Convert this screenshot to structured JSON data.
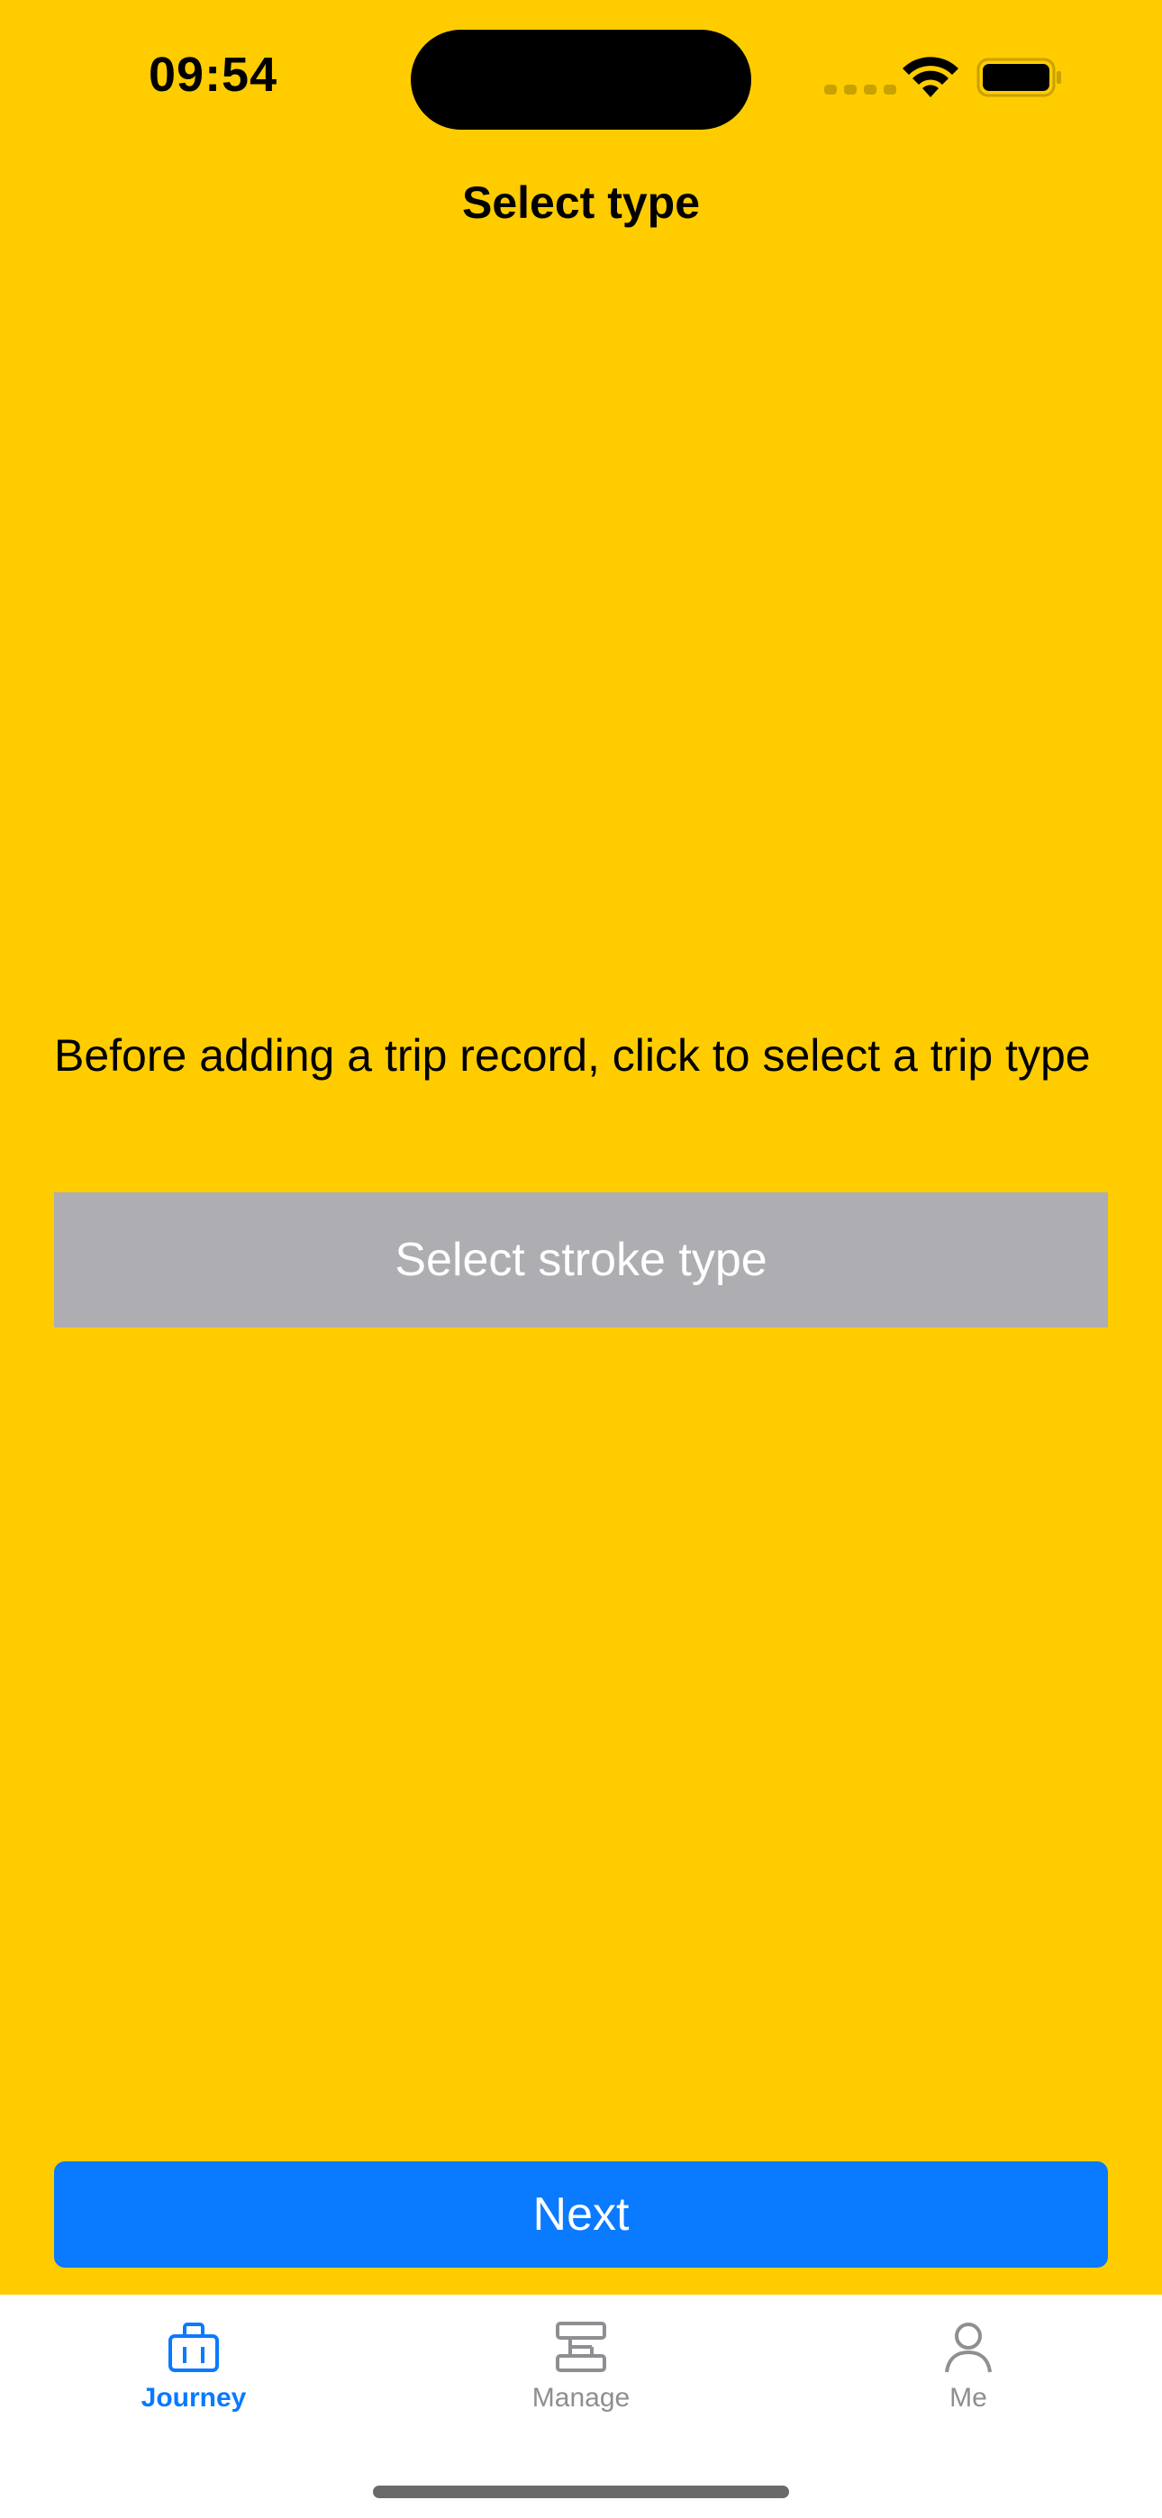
{
  "status_bar": {
    "time": "09:54"
  },
  "nav": {
    "title": "Select type"
  },
  "main": {
    "instruction": "Before adding a trip record, click to select a trip type",
    "select_button_label": "Select stroke type",
    "next_button_label": "Next"
  },
  "tab_bar": {
    "tabs": [
      {
        "label": "Journey",
        "icon": "suitcase-icon",
        "active": true
      },
      {
        "label": "Manage",
        "icon": "manage-icon",
        "active": false
      },
      {
        "label": "Me",
        "icon": "person-icon",
        "active": false
      }
    ]
  },
  "colors": {
    "background": "#FFCC00",
    "accent": "#0A7AFF",
    "select_button": "#AEADB2",
    "inactive_tab": "#8E8E93"
  }
}
